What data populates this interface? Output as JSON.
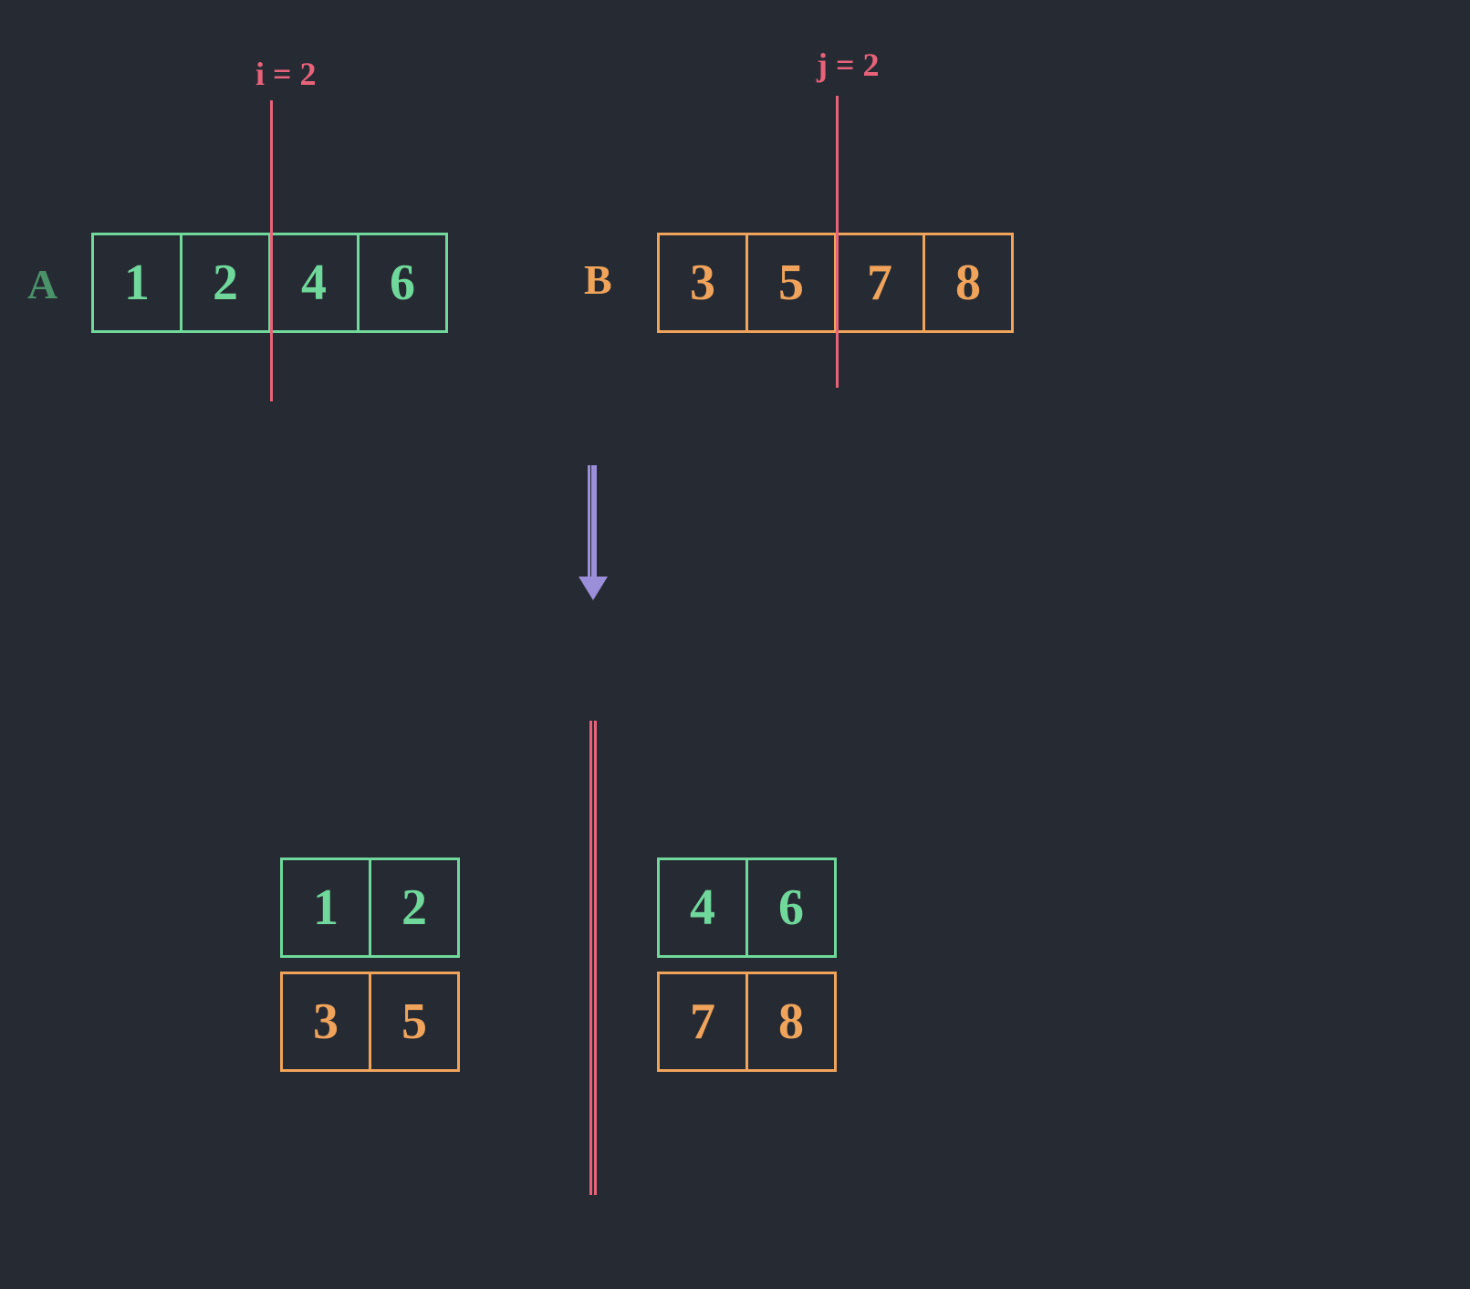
{
  "labels": {
    "A": "A",
    "B": "B",
    "i": "i = 2",
    "j": "j = 2"
  },
  "arrayA": [
    "1",
    "2",
    "4",
    "6"
  ],
  "arrayB": [
    "3",
    "5",
    "7",
    "8"
  ],
  "split": {
    "leftTop": [
      "1",
      "2"
    ],
    "leftBot": [
      "3",
      "5"
    ],
    "rightTop": [
      "4",
      "6"
    ],
    "rightBot": [
      "7",
      "8"
    ]
  },
  "colors": {
    "green": "#6fd89a",
    "orange": "#f0a45b",
    "red": "#e8637a",
    "purple": "#9b8fd9",
    "bg": "#262a33"
  }
}
